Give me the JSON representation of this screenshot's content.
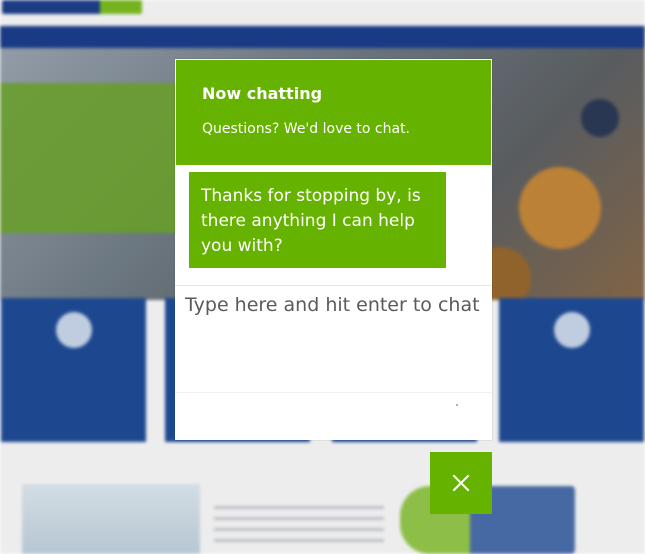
{
  "chat": {
    "title": "Now chatting",
    "subtitle": "Questions? We'd love to chat.",
    "messages": [
      {
        "from": "agent",
        "text": "Thanks for stopping by, is there anything I can help you with?"
      }
    ],
    "input": {
      "placeholder": "Type here and hit enter to chat",
      "value": ""
    },
    "close_icon": "close-icon"
  },
  "colors": {
    "accent_green": "#66b200",
    "site_blue": "#1e4c9b",
    "site_nav_blue": "#1a3d8f"
  }
}
